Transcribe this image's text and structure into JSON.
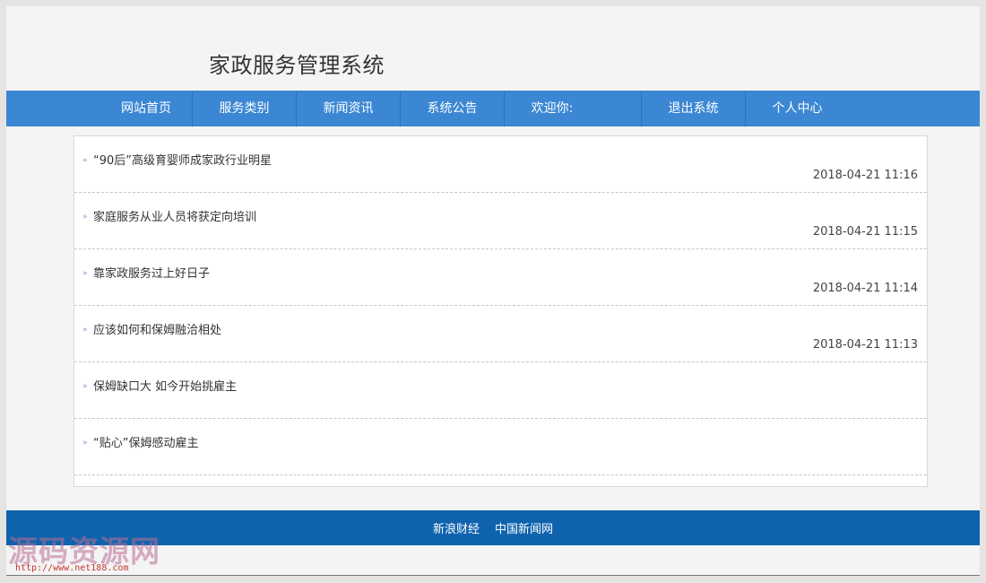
{
  "header": {
    "title": "家政服务管理系统"
  },
  "nav": {
    "items": [
      {
        "label": "网站首页"
      },
      {
        "label": "服务类别"
      },
      {
        "label": "新闻资讯"
      },
      {
        "label": "系统公告"
      },
      {
        "label": "欢迎你:"
      },
      {
        "label": "退出系统"
      },
      {
        "label": "个人中心"
      }
    ]
  },
  "news": {
    "bullet_glyph": "»",
    "items": [
      {
        "title": "“90后”高级育婴师成家政行业明星",
        "date": "2018-04-21 11:16"
      },
      {
        "title": "家庭服务从业人员将获定向培训",
        "date": "2018-04-21 11:15"
      },
      {
        "title": "靠家政服务过上好日子",
        "date": "2018-04-21 11:14"
      },
      {
        "title": "应该如何和保姆融洽相处",
        "date": "2018-04-21 11:13"
      },
      {
        "title": "保姆缺口大 如今开始挑雇主",
        "date": ""
      },
      {
        "title": "“贴心”保姆感动雇主",
        "date": ""
      }
    ]
  },
  "footer": {
    "links": [
      {
        "label": "新浪财经"
      },
      {
        "label": "中国新闻网"
      }
    ]
  },
  "watermark": {
    "text": "源码资源网",
    "url": "http://www.net188.com"
  },
  "colors": {
    "nav_bg": "#3b87d4",
    "footer_bg": "#0f63ad",
    "page_bg": "#f4f4f4"
  }
}
